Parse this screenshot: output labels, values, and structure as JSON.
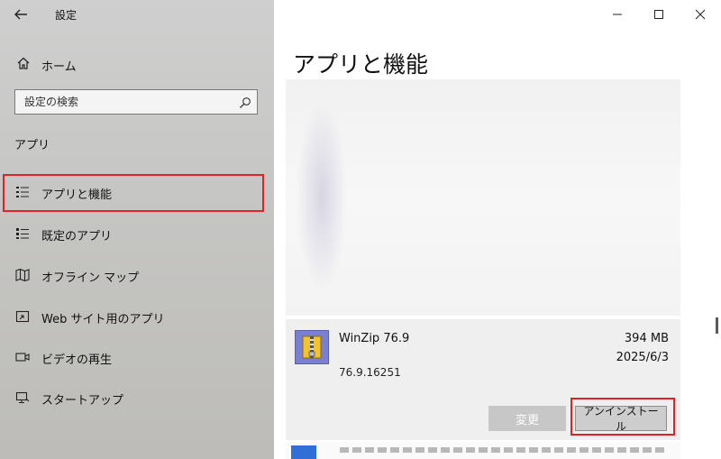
{
  "window": {
    "title": "設定"
  },
  "sidebar": {
    "home_label": "ホーム",
    "search_placeholder": "設定の検索",
    "section_heading": "アプリ",
    "items": [
      {
        "label": "アプリと機能",
        "icon": "apps-list-icon",
        "selected": true
      },
      {
        "label": "既定のアプリ",
        "icon": "default-apps-icon",
        "selected": false
      },
      {
        "label": "オフライン マップ",
        "icon": "map-icon",
        "selected": false
      },
      {
        "label": "Web サイト用のアプリ",
        "icon": "web-app-icon",
        "selected": false
      },
      {
        "label": "ビデオの再生",
        "icon": "video-icon",
        "selected": false
      },
      {
        "label": "スタートアップ",
        "icon": "startup-icon",
        "selected": false
      }
    ]
  },
  "main": {
    "title": "アプリと機能",
    "app": {
      "name": "WinZip 76.9",
      "size": "394 MB",
      "date": "2025/6/3",
      "version": "76.9.16251",
      "modify_label": "変更",
      "uninstall_label": "アンインストール"
    }
  },
  "colors": {
    "highlight": "#e02424",
    "app_icon": "#7a7fd1"
  }
}
